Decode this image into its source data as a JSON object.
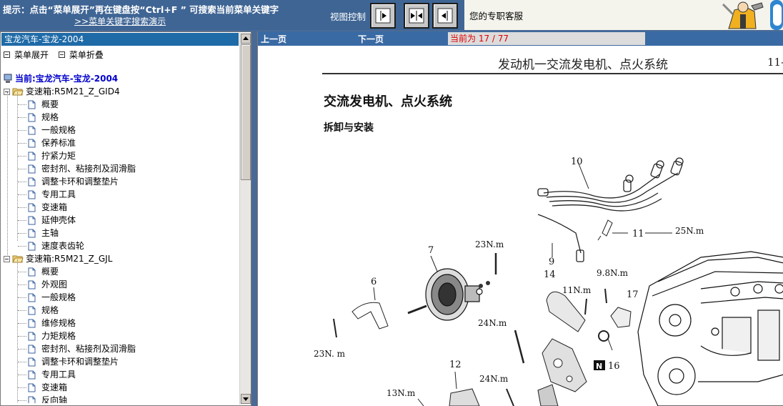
{
  "topbar": {
    "hint": "提示：点击“菜单展开”再在键盘按“Ctrl+F ” 可搜索当前菜单关键字",
    "demo_link": ">>菜单关键字搜索演示",
    "view_control_label": "视图控制",
    "service_text": "您的专职客服"
  },
  "left": {
    "title": "宝龙汽车-宝龙-2004",
    "expand_menu": "菜单展开",
    "collapse_menu": "菜单折叠",
    "current": "当前:宝龙汽车-宝龙-2004",
    "groups": [
      {
        "label": "变速箱:R5M21_Z_GID4",
        "items": [
          "概要",
          "规格",
          "一般规格",
          "保养标准",
          "拧紧力矩",
          "密封剂、粘接剂及润滑脂",
          "调整卡环和调整垫片",
          "专用工具",
          "变速箱",
          "延伸壳体",
          "主轴",
          "速度表齿轮"
        ]
      },
      {
        "label": "变速箱:R5M21_Z_GJL",
        "items": [
          "概要",
          "外观图",
          "一般规格",
          "规格",
          "维修规格",
          "力矩规格",
          "密封剂、粘接剂及润滑脂",
          "调整卡环和调整垫片",
          "专用工具",
          "变速箱",
          "反向轴"
        ]
      }
    ]
  },
  "right": {
    "prev": "上一页",
    "next": "下一页",
    "page_indicator": "当前为  17 / 77",
    "doc": {
      "header": "发动机一交流发电机、点火系统",
      "page_number": "11-",
      "title": "交流发电机、点火系统",
      "subtitle": "拆卸与安装"
    },
    "diagram_labels": {
      "n10": "10",
      "n11": "11",
      "t25": "25N.m",
      "n9": "9",
      "n7": "7",
      "t23a": "23N.m",
      "n6": "6",
      "n14": "14",
      "t98": "9.8N.m",
      "t11": "11N.m",
      "n17": "17",
      "t24a": "24N.m",
      "t23b": "23N. m",
      "n16": "16",
      "badge_n": "N",
      "n12": "12",
      "t24b": "24N.m",
      "t13": "13N.m"
    }
  }
}
